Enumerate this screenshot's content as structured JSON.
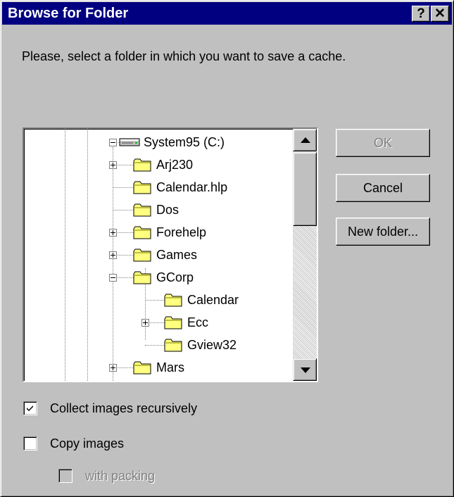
{
  "window": {
    "title": "Browse for Folder",
    "help_label": "?",
    "close_label": "✕"
  },
  "instruction": "Please, select a folder in which you want to save a cache.",
  "tree": {
    "drive_label": "System95 (C:)",
    "items": [
      {
        "label": "Arj230",
        "expander": "+"
      },
      {
        "label": "Calendar.hlp",
        "expander": ""
      },
      {
        "label": "Dos",
        "expander": ""
      },
      {
        "label": "Forehelp",
        "expander": "+"
      },
      {
        "label": "Games",
        "expander": "+"
      },
      {
        "label": "GCorp",
        "expander": "-"
      },
      {
        "label": "Calendar",
        "expander": ""
      },
      {
        "label": "Ecc",
        "expander": "+"
      },
      {
        "label": "Gview32",
        "expander": ""
      },
      {
        "label": "Mars",
        "expander": "+"
      }
    ]
  },
  "buttons": {
    "ok": "OK",
    "cancel": "Cancel",
    "new_folder": "New folder..."
  },
  "options": {
    "collect_recursively": {
      "label": "Collect images recursively",
      "checked": true
    },
    "copy_images": {
      "label": "Copy images",
      "checked": false
    },
    "with_packing": {
      "label": "with packing",
      "checked": false,
      "enabled": false
    }
  },
  "colors": {
    "titlebar": "#000080",
    "face": "#c0c0c0",
    "folder": "#ffff80"
  }
}
